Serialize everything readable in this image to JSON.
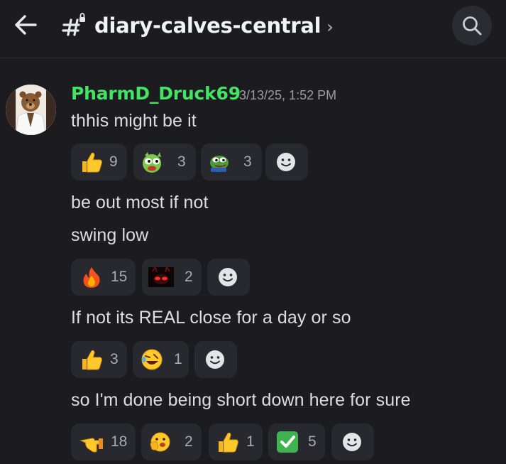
{
  "header": {
    "channel_name": "diary-calves-central",
    "chevron": "›"
  },
  "message": {
    "author": "PharmD_Druck69",
    "author_color": "#43e463",
    "timestamp": "3/13/25, 1:52 PM",
    "lines": [
      "thhis might be it",
      "be out most if not",
      "swing low",
      "If not its REAL close for a day or so",
      "so I'm done being short down here for sure"
    ]
  },
  "reactions": {
    "row1": [
      {
        "emoji": "thumbs-up",
        "count": "9"
      },
      {
        "emoji": "pepe-green-frog",
        "count": "3"
      },
      {
        "emoji": "pepe-smug",
        "count": "3"
      }
    ],
    "row2": [
      {
        "emoji": "fire",
        "count": "15"
      },
      {
        "emoji": "red-eyes-demon",
        "count": "2"
      }
    ],
    "row3": [
      {
        "emoji": "thumbs-up",
        "count": "3"
      },
      {
        "emoji": "rolling-on-floor-laughing",
        "count": "1"
      }
    ],
    "row4": [
      {
        "emoji": "pointing-hand",
        "count": "18"
      },
      {
        "emoji": "hand-over-mouth",
        "count": "2"
      },
      {
        "emoji": "thumbs-up",
        "count": "1"
      },
      {
        "emoji": "check-mark-button",
        "count": "5"
      }
    ]
  }
}
